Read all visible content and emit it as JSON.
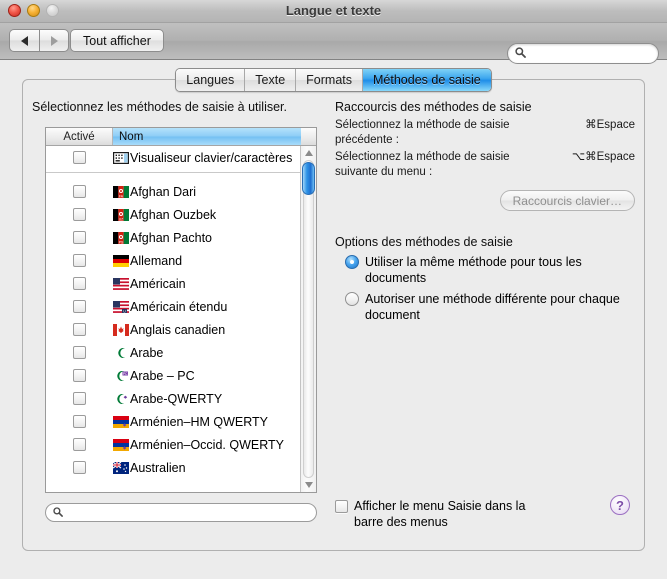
{
  "window": {
    "title": "Langue et texte",
    "traffic_lights": [
      "close",
      "minimize",
      "zoom"
    ]
  },
  "toolbar": {
    "back_label": "◀",
    "forward_label": "▶",
    "show_all_label": "Tout afficher",
    "search_value": "",
    "search_placeholder": ""
  },
  "tabs": [
    {
      "label": "Langues",
      "active": false
    },
    {
      "label": "Texte",
      "active": false
    },
    {
      "label": "Formats",
      "active": false
    },
    {
      "label": "Méthodes de saisie",
      "active": true
    }
  ],
  "main": {
    "intro_label": "Sélectionnez les méthodes de saisie à utiliser.",
    "list": {
      "columns": [
        "Activé",
        "Nom"
      ],
      "sorted_column": "Nom",
      "pinned_items": [
        {
          "label": "Visualiseur clavier/caractères",
          "checked": false,
          "icon": "keyboard-viewer-icon"
        }
      ],
      "items": [
        {
          "label": "Afghan Dari",
          "checked": false,
          "flag": "afghanistan"
        },
        {
          "label": "Afghan Ouzbek",
          "checked": false,
          "flag": "afghanistan"
        },
        {
          "label": "Afghan Pachto",
          "checked": false,
          "flag": "afghanistan"
        },
        {
          "label": "Allemand",
          "checked": false,
          "flag": "germany"
        },
        {
          "label": "Américain",
          "checked": false,
          "flag": "usa"
        },
        {
          "label": "Américain étendu",
          "checked": false,
          "flag": "usa"
        },
        {
          "label": "Anglais canadien",
          "checked": false,
          "flag": "canada"
        },
        {
          "label": "Arabe",
          "checked": false,
          "flag": "arabic"
        },
        {
          "label": "Arabe – PC",
          "checked": false,
          "flag": "arabic"
        },
        {
          "label": "Arabe-QWERTY",
          "checked": false,
          "flag": "arabic"
        },
        {
          "label": "Arménien–HM QWERTY",
          "checked": false,
          "flag": "armenia"
        },
        {
          "label": "Arménien–Occid. QWERTY",
          "checked": false,
          "flag": "armenia"
        },
        {
          "label": "Australien",
          "checked": false,
          "flag": "australia"
        }
      ]
    },
    "filter_search": {
      "value": "",
      "placeholder": ""
    },
    "shortcuts": {
      "title": "Raccourcis des méthodes de saisie",
      "rows": [
        {
          "label": "Sélectionnez la méthode de saisie précédente :",
          "key": "⌘Espace"
        },
        {
          "label": "Sélectionnez la méthode de saisie suivante du menu :",
          "key": "⌥⌘Espace"
        }
      ],
      "button_label": "Raccourcis clavier…"
    },
    "options": {
      "title": "Options des méthodes de saisie",
      "radios": [
        {
          "label": "Utiliser la même méthode pour tous les documents",
          "selected": true
        },
        {
          "label": "Autoriser une méthode différente pour chaque document",
          "selected": false
        }
      ]
    },
    "menu_checkbox": {
      "label": "Afficher le menu Saisie dans la barre des menus",
      "checked": false
    },
    "help_label": "?"
  },
  "colors": {
    "accent_blue": "#1f8ee8",
    "header_blue": "#8ecdf6",
    "help_purple": "#7d4ea8",
    "window_bg": "#ececec"
  }
}
